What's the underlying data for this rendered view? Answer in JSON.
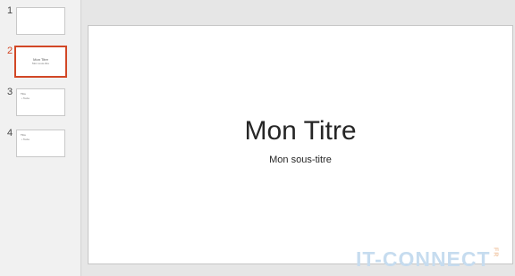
{
  "thumbnails": [
    {
      "number": "1"
    },
    {
      "number": "2",
      "title": "Mon Titre",
      "subtitle": "Mon sous-titre"
    },
    {
      "number": "3",
      "title": "Titre",
      "bullet": "• Texte"
    },
    {
      "number": "4",
      "title": "Titre",
      "bullet": "• Texte"
    }
  ],
  "slide": {
    "title": "Mon Titre",
    "subtitle": "Mon sous-titre"
  },
  "watermark": {
    "text": "IT-CONNECT",
    "suffix": "FR"
  },
  "colors": {
    "selection_accent": "#d24726",
    "watermark": "#c6dcef"
  }
}
